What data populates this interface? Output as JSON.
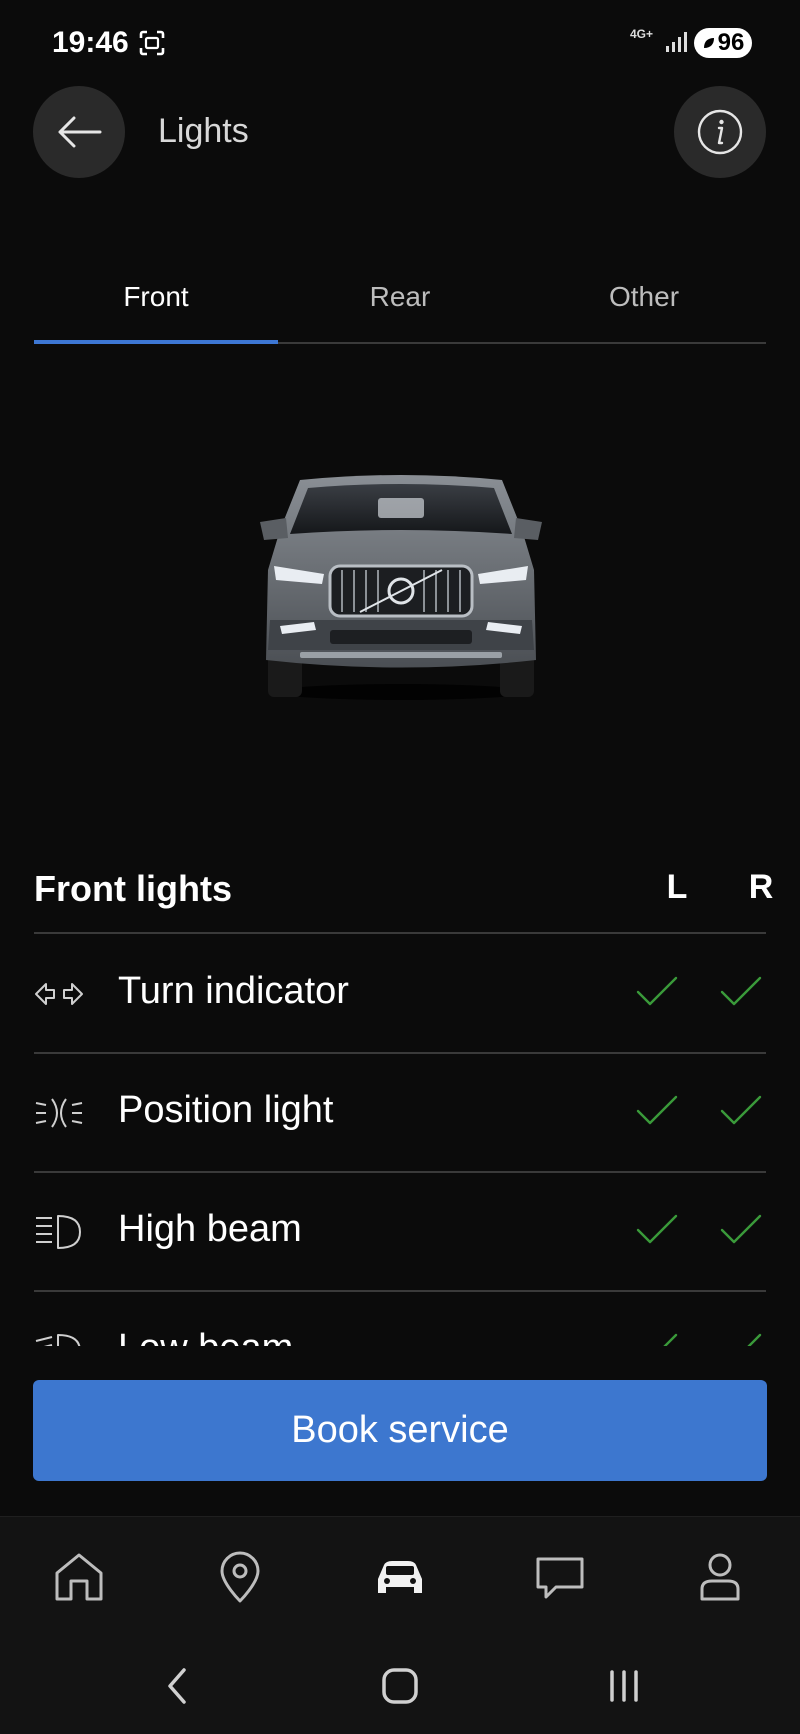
{
  "status_bar": {
    "time": "19:46",
    "network": "4G+",
    "battery": "96"
  },
  "header": {
    "title": "Lights"
  },
  "tabs": [
    {
      "label": "Front",
      "active": true
    },
    {
      "label": "Rear",
      "active": false
    },
    {
      "label": "Other",
      "active": false
    }
  ],
  "lights": {
    "title": "Front lights",
    "col_left": "L",
    "col_right": "R",
    "rows": [
      {
        "label": "Turn indicator",
        "icon": "turn-indicator-icon",
        "left_ok": true,
        "right_ok": true
      },
      {
        "label": "Position light",
        "icon": "position-light-icon",
        "left_ok": true,
        "right_ok": true
      },
      {
        "label": "High beam",
        "icon": "high-beam-icon",
        "left_ok": true,
        "right_ok": true
      },
      {
        "label": "Low beam",
        "icon": "low-beam-icon",
        "left_ok": true,
        "right_ok": true
      }
    ]
  },
  "book_button": {
    "label": "Book service"
  },
  "colors": {
    "accent": "#3d77d4",
    "ok": "#3a9a3a",
    "background": "#0b0b0b"
  },
  "bottom_nav": [
    {
      "name": "home-icon",
      "active": false
    },
    {
      "name": "location-pin-icon",
      "active": false
    },
    {
      "name": "car-icon",
      "active": true
    },
    {
      "name": "chat-icon",
      "active": false
    },
    {
      "name": "profile-icon",
      "active": false
    }
  ]
}
